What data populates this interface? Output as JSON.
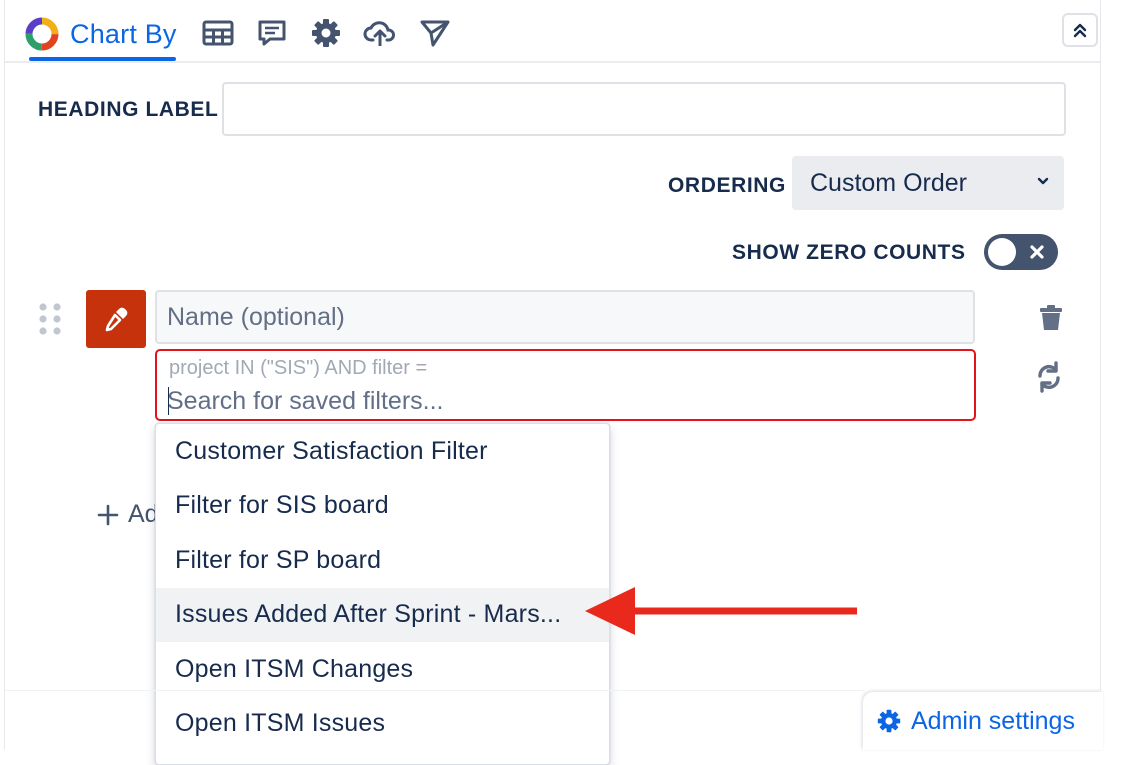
{
  "tabs": {
    "active_label": "Chart By",
    "icons": [
      "table-icon",
      "comment-icon",
      "gear-icon",
      "cloud-upload-icon",
      "send-icon"
    ]
  },
  "form": {
    "heading_label": "HEADING LABEL",
    "heading_value": "",
    "ordering_label": "ORDERING",
    "ordering_value": "Custom Order",
    "show_zero_label": "SHOW ZERO COUNTS",
    "show_zero_on": false
  },
  "series": {
    "name_placeholder": "Name (optional)",
    "jql_prefix": "project IN (\"SIS\") AND filter =",
    "search_placeholder": "Search for saved filters...",
    "color": "#c6320b"
  },
  "dropdown": {
    "items": [
      "Customer Satisfaction Filter",
      "Filter for SIS board",
      "Filter for SP board",
      "Issues Added After Sprint - Mars...",
      "Open ITSM Changes",
      "Open ITSM Issues"
    ],
    "hovered_index": 3
  },
  "add_label": "Ad",
  "admin": {
    "label": "Admin settings"
  },
  "colors": {
    "accent": "#0C66E4",
    "error": "#e2131a",
    "arrow": "#e8291c"
  }
}
